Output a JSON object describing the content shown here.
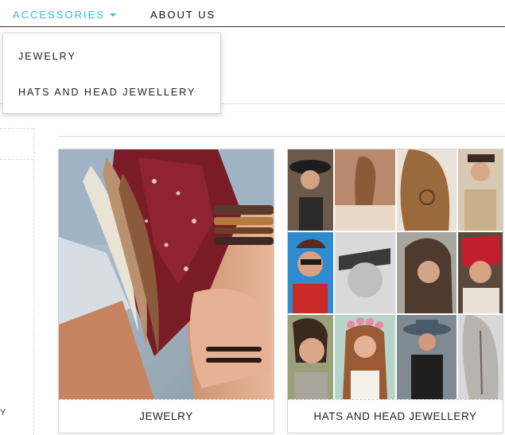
{
  "nav": {
    "items": [
      {
        "label": "ACCESSORIES",
        "active": true
      },
      {
        "label": "ABOUT US",
        "active": false
      }
    ],
    "accent_color": "#38b6d6"
  },
  "dropdown": {
    "items": [
      {
        "label": "JEWELRY"
      },
      {
        "label": "HATS AND HEAD JEWELLERY"
      }
    ]
  },
  "sidebar": {
    "fragment_text": "Y"
  },
  "categories": [
    {
      "label": "JEWELRY",
      "image": "feather-bracelet-photo"
    },
    {
      "label": "HATS AND HEAD JEWELLERY",
      "image": "hats-headpieces-collage"
    }
  ]
}
